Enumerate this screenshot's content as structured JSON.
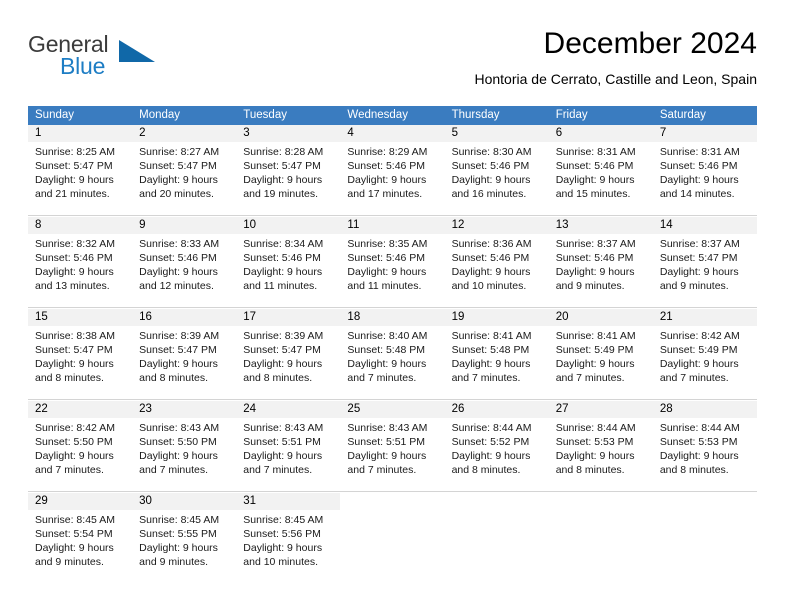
{
  "brand": {
    "name_part1": "General",
    "name_part2": "Blue",
    "triangle_color": "#1068a8",
    "blue": "#1d7dc4"
  },
  "header": {
    "title": "December 2024",
    "location": "Hontoria de Cerrato, Castille and Leon, Spain"
  },
  "calendar": {
    "header_bg": "#3a7cc0",
    "date_strip_bg": "#f2f2f2",
    "weekdays": [
      "Sunday",
      "Monday",
      "Tuesday",
      "Wednesday",
      "Thursday",
      "Friday",
      "Saturday"
    ],
    "weeks": [
      [
        {
          "day": "1",
          "sunrise": "Sunrise: 8:25 AM",
          "sunset": "Sunset: 5:47 PM",
          "daylight_line1": "Daylight: 9 hours",
          "daylight_line2": "and 21 minutes."
        },
        {
          "day": "2",
          "sunrise": "Sunrise: 8:27 AM",
          "sunset": "Sunset: 5:47 PM",
          "daylight_line1": "Daylight: 9 hours",
          "daylight_line2": "and 20 minutes."
        },
        {
          "day": "3",
          "sunrise": "Sunrise: 8:28 AM",
          "sunset": "Sunset: 5:47 PM",
          "daylight_line1": "Daylight: 9 hours",
          "daylight_line2": "and 19 minutes."
        },
        {
          "day": "4",
          "sunrise": "Sunrise: 8:29 AM",
          "sunset": "Sunset: 5:46 PM",
          "daylight_line1": "Daylight: 9 hours",
          "daylight_line2": "and 17 minutes."
        },
        {
          "day": "5",
          "sunrise": "Sunrise: 8:30 AM",
          "sunset": "Sunset: 5:46 PM",
          "daylight_line1": "Daylight: 9 hours",
          "daylight_line2": "and 16 minutes."
        },
        {
          "day": "6",
          "sunrise": "Sunrise: 8:31 AM",
          "sunset": "Sunset: 5:46 PM",
          "daylight_line1": "Daylight: 9 hours",
          "daylight_line2": "and 15 minutes."
        },
        {
          "day": "7",
          "sunrise": "Sunrise: 8:31 AM",
          "sunset": "Sunset: 5:46 PM",
          "daylight_line1": "Daylight: 9 hours",
          "daylight_line2": "and 14 minutes."
        }
      ],
      [
        {
          "day": "8",
          "sunrise": "Sunrise: 8:32 AM",
          "sunset": "Sunset: 5:46 PM",
          "daylight_line1": "Daylight: 9 hours",
          "daylight_line2": "and 13 minutes."
        },
        {
          "day": "9",
          "sunrise": "Sunrise: 8:33 AM",
          "sunset": "Sunset: 5:46 PM",
          "daylight_line1": "Daylight: 9 hours",
          "daylight_line2": "and 12 minutes."
        },
        {
          "day": "10",
          "sunrise": "Sunrise: 8:34 AM",
          "sunset": "Sunset: 5:46 PM",
          "daylight_line1": "Daylight: 9 hours",
          "daylight_line2": "and 11 minutes."
        },
        {
          "day": "11",
          "sunrise": "Sunrise: 8:35 AM",
          "sunset": "Sunset: 5:46 PM",
          "daylight_line1": "Daylight: 9 hours",
          "daylight_line2": "and 11 minutes."
        },
        {
          "day": "12",
          "sunrise": "Sunrise: 8:36 AM",
          "sunset": "Sunset: 5:46 PM",
          "daylight_line1": "Daylight: 9 hours",
          "daylight_line2": "and 10 minutes."
        },
        {
          "day": "13",
          "sunrise": "Sunrise: 8:37 AM",
          "sunset": "Sunset: 5:46 PM",
          "daylight_line1": "Daylight: 9 hours",
          "daylight_line2": "and 9 minutes."
        },
        {
          "day": "14",
          "sunrise": "Sunrise: 8:37 AM",
          "sunset": "Sunset: 5:47 PM",
          "daylight_line1": "Daylight: 9 hours",
          "daylight_line2": "and 9 minutes."
        }
      ],
      [
        {
          "day": "15",
          "sunrise": "Sunrise: 8:38 AM",
          "sunset": "Sunset: 5:47 PM",
          "daylight_line1": "Daylight: 9 hours",
          "daylight_line2": "and 8 minutes."
        },
        {
          "day": "16",
          "sunrise": "Sunrise: 8:39 AM",
          "sunset": "Sunset: 5:47 PM",
          "daylight_line1": "Daylight: 9 hours",
          "daylight_line2": "and 8 minutes."
        },
        {
          "day": "17",
          "sunrise": "Sunrise: 8:39 AM",
          "sunset": "Sunset: 5:47 PM",
          "daylight_line1": "Daylight: 9 hours",
          "daylight_line2": "and 8 minutes."
        },
        {
          "day": "18",
          "sunrise": "Sunrise: 8:40 AM",
          "sunset": "Sunset: 5:48 PM",
          "daylight_line1": "Daylight: 9 hours",
          "daylight_line2": "and 7 minutes."
        },
        {
          "day": "19",
          "sunrise": "Sunrise: 8:41 AM",
          "sunset": "Sunset: 5:48 PM",
          "daylight_line1": "Daylight: 9 hours",
          "daylight_line2": "and 7 minutes."
        },
        {
          "day": "20",
          "sunrise": "Sunrise: 8:41 AM",
          "sunset": "Sunset: 5:49 PM",
          "daylight_line1": "Daylight: 9 hours",
          "daylight_line2": "and 7 minutes."
        },
        {
          "day": "21",
          "sunrise": "Sunrise: 8:42 AM",
          "sunset": "Sunset: 5:49 PM",
          "daylight_line1": "Daylight: 9 hours",
          "daylight_line2": "and 7 minutes."
        }
      ],
      [
        {
          "day": "22",
          "sunrise": "Sunrise: 8:42 AM",
          "sunset": "Sunset: 5:50 PM",
          "daylight_line1": "Daylight: 9 hours",
          "daylight_line2": "and 7 minutes."
        },
        {
          "day": "23",
          "sunrise": "Sunrise: 8:43 AM",
          "sunset": "Sunset: 5:50 PM",
          "daylight_line1": "Daylight: 9 hours",
          "daylight_line2": "and 7 minutes."
        },
        {
          "day": "24",
          "sunrise": "Sunrise: 8:43 AM",
          "sunset": "Sunset: 5:51 PM",
          "daylight_line1": "Daylight: 9 hours",
          "daylight_line2": "and 7 minutes."
        },
        {
          "day": "25",
          "sunrise": "Sunrise: 8:43 AM",
          "sunset": "Sunset: 5:51 PM",
          "daylight_line1": "Daylight: 9 hours",
          "daylight_line2": "and 7 minutes."
        },
        {
          "day": "26",
          "sunrise": "Sunrise: 8:44 AM",
          "sunset": "Sunset: 5:52 PM",
          "daylight_line1": "Daylight: 9 hours",
          "daylight_line2": "and 8 minutes."
        },
        {
          "day": "27",
          "sunrise": "Sunrise: 8:44 AM",
          "sunset": "Sunset: 5:53 PM",
          "daylight_line1": "Daylight: 9 hours",
          "daylight_line2": "and 8 minutes."
        },
        {
          "day": "28",
          "sunrise": "Sunrise: 8:44 AM",
          "sunset": "Sunset: 5:53 PM",
          "daylight_line1": "Daylight: 9 hours",
          "daylight_line2": "and 8 minutes."
        }
      ],
      [
        {
          "day": "29",
          "sunrise": "Sunrise: 8:45 AM",
          "sunset": "Sunset: 5:54 PM",
          "daylight_line1": "Daylight: 9 hours",
          "daylight_line2": "and 9 minutes."
        },
        {
          "day": "30",
          "sunrise": "Sunrise: 8:45 AM",
          "sunset": "Sunset: 5:55 PM",
          "daylight_line1": "Daylight: 9 hours",
          "daylight_line2": "and 9 minutes."
        },
        {
          "day": "31",
          "sunrise": "Sunrise: 8:45 AM",
          "sunset": "Sunset: 5:56 PM",
          "daylight_line1": "Daylight: 9 hours",
          "daylight_line2": "and 10 minutes."
        },
        {
          "day": "",
          "sunrise": "",
          "sunset": "",
          "daylight_line1": "",
          "daylight_line2": ""
        },
        {
          "day": "",
          "sunrise": "",
          "sunset": "",
          "daylight_line1": "",
          "daylight_line2": ""
        },
        {
          "day": "",
          "sunrise": "",
          "sunset": "",
          "daylight_line1": "",
          "daylight_line2": ""
        },
        {
          "day": "",
          "sunrise": "",
          "sunset": "",
          "daylight_line1": "",
          "daylight_line2": ""
        }
      ]
    ]
  }
}
